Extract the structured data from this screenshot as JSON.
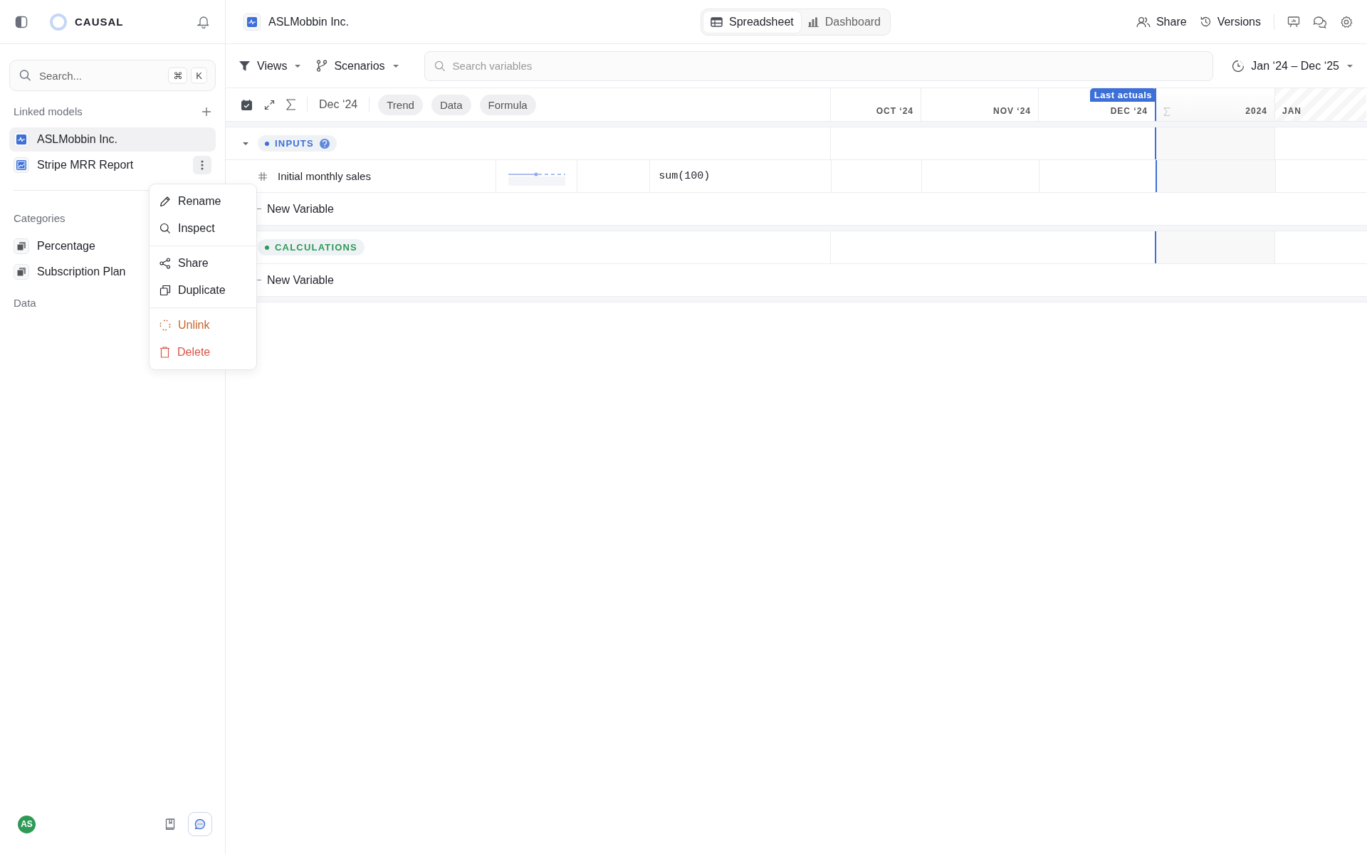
{
  "sidebar": {
    "logo": "CAUSAL",
    "search": {
      "placeholder": "Search...",
      "keys": [
        "⌘",
        "K"
      ]
    },
    "linked_models": {
      "title": "Linked models",
      "items": [
        {
          "label": "ASLMobbin Inc.",
          "selected": true,
          "menu_open": false
        },
        {
          "label": "Stripe MRR Report",
          "selected": false,
          "menu_open": true
        }
      ]
    },
    "categories": {
      "title": "Categories",
      "items": [
        "Percentage",
        "Subscription Plan"
      ]
    },
    "data": {
      "title": "Data"
    },
    "user": {
      "initials": "AS"
    }
  },
  "context_menu": {
    "groups": [
      [
        {
          "label": "Rename",
          "kind": "rename",
          "color": "#23252b"
        },
        {
          "label": "Inspect",
          "kind": "inspect",
          "color": "#23252b"
        }
      ],
      [
        {
          "label": "Share",
          "kind": "share",
          "color": "#23252b"
        },
        {
          "label": "Duplicate",
          "kind": "duplicate",
          "color": "#23252b"
        }
      ],
      [
        {
          "label": "Unlink",
          "kind": "unlink",
          "color": "#c8652e"
        },
        {
          "label": "Delete",
          "kind": "delete",
          "color": "#d85548"
        }
      ]
    ]
  },
  "header": {
    "model": "ASLMobbin Inc.",
    "view_tabs": [
      {
        "label": "Spreadsheet",
        "kind": "spreadsheet",
        "selected": true
      },
      {
        "label": "Dashboard",
        "kind": "dashboard",
        "selected": false
      }
    ],
    "actions": [
      {
        "label": "Share",
        "kind": "share"
      },
      {
        "label": "Versions",
        "kind": "versions"
      }
    ]
  },
  "toolbar": {
    "views": "Views",
    "scenarios": "Scenarios",
    "search": {
      "placeholder": "Search variables"
    },
    "date_range": "Jan ‘24 – Dec ‘25"
  },
  "grid": {
    "date": "Dec ‘24",
    "chips": [
      "Trend",
      "Data",
      "Formula"
    ],
    "last_actuals": "Last actuals",
    "columns": [
      {
        "label": "OCT ‘24",
        "kind": "month"
      },
      {
        "label": "NOV ‘24",
        "kind": "month"
      },
      {
        "label": "DEC ‘24",
        "kind": "actuals_end"
      },
      {
        "label": "2024",
        "kind": "total"
      },
      {
        "label": "JAN",
        "kind": "forecast"
      }
    ],
    "sections": [
      {
        "label": "INPUTS",
        "color": "#3d6fd8",
        "expanded": true,
        "help": true,
        "variables": [
          {
            "name": "Initial monthly sales",
            "formula": "sum(100)"
          }
        ],
        "new_label": "New Variable"
      },
      {
        "label": "CALCULATIONS",
        "color": "#2e9a56",
        "help": false,
        "new_label": "New Variable"
      }
    ]
  }
}
